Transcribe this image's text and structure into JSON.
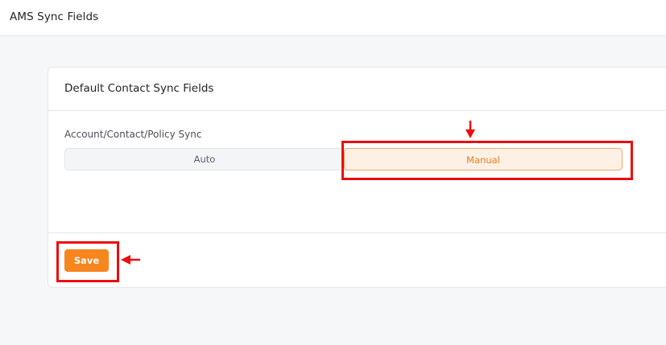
{
  "header": {
    "title": "AMS Sync Fields"
  },
  "card": {
    "title": "Default Contact Sync Fields",
    "field_label": "Account/Contact/Policy Sync",
    "options": [
      {
        "label": "Auto",
        "selected": false
      },
      {
        "label": "Manual",
        "selected": true
      }
    ],
    "save_label": "Save"
  },
  "colors": {
    "accent": "#f7861f",
    "selected_text": "#f07c1d",
    "selected_bg": "#fdf1e6",
    "annotation": "#ee0c0c"
  }
}
